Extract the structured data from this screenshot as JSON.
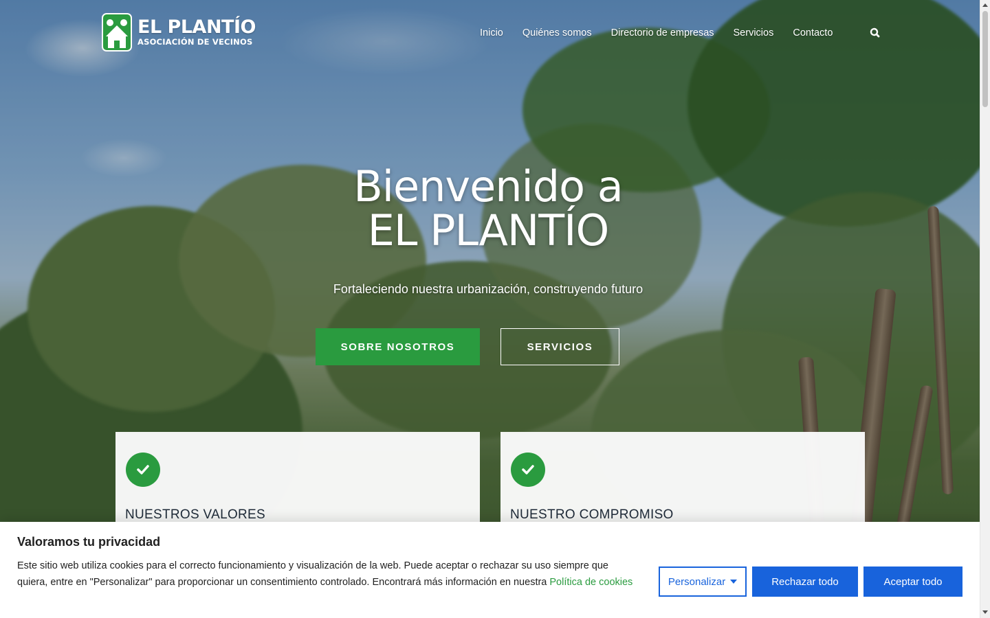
{
  "brand": {
    "title": "EL PLANTÍO",
    "subtitle": "ASOCIACIÓN DE VECINOS",
    "accent_color": "#2a9b3f"
  },
  "nav": {
    "items": [
      {
        "label": "Inicio"
      },
      {
        "label": "Quiénes somos"
      },
      {
        "label": "Directorio de empresas"
      },
      {
        "label": "Servicios"
      },
      {
        "label": "Contacto"
      }
    ],
    "search_icon": "search-icon"
  },
  "hero": {
    "title_line1": "Bienvenido a",
    "title_line2": "EL PLANTÍO",
    "subtitle": "Fortaleciendo nuestra urbanización, construyendo futuro",
    "primary_button": "SOBRE NOSOTROS",
    "secondary_button": "SERVICIOS"
  },
  "cards": [
    {
      "title": "NUESTROS VALORES",
      "icon": "check-icon"
    },
    {
      "title": "NUESTRO COMPROMISO",
      "icon": "check-icon"
    }
  ],
  "cookie_banner": {
    "title": "Valoramos tu privacidad",
    "text": "Este sitio web utiliza cookies para el correcto funcionamiento y visualización de la web. Puede aceptar o rechazar su uso siempre que quiera, entre en \"Personalizar\" para proporcionar un consentimiento controlado. Encontrará más información en nuestra ",
    "link_text": "Política de cookies",
    "customize_button": "Personalizar",
    "reject_button": "Rechazar todo",
    "accept_button": "Aceptar todo",
    "button_color": "#1863dc"
  }
}
